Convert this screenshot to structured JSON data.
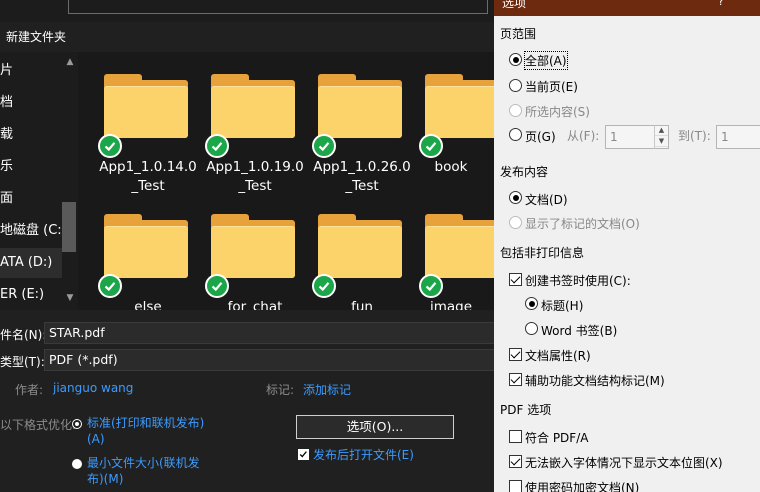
{
  "save_dialog": {
    "toolbar": {
      "new_folder": "新建文件夹"
    },
    "nav_items": [
      {
        "label": "片",
        "selected": false
      },
      {
        "label": "档",
        "selected": false
      },
      {
        "label": "载",
        "selected": false
      },
      {
        "label": "乐",
        "selected": false
      },
      {
        "label": "面",
        "selected": false
      },
      {
        "label": "地磁盘 (C:)",
        "selected": false
      },
      {
        "label": "ATA (D:)",
        "selected": true
      },
      {
        "label": "ER (E:)",
        "selected": false
      }
    ],
    "nav_scroll": {
      "up": "▲",
      "down": "▼"
    },
    "files": [
      {
        "line1": "App1_1.0.14.0",
        "line2": "_Test"
      },
      {
        "line1": "App1_1.0.19.0",
        "line2": "_Test"
      },
      {
        "line1": "App1_1.0.26.0",
        "line2": "_Test"
      },
      {
        "line1": "book",
        "line2": ""
      },
      {
        "line1": "else",
        "line2": ""
      },
      {
        "line1": "for_chat",
        "line2": ""
      },
      {
        "line1": "fun",
        "line2": ""
      },
      {
        "line1": "image",
        "line2": ""
      }
    ],
    "filename_label": "件名(N):",
    "filename_value": "STAR.pdf",
    "filetype_label": "类型(T):",
    "filetype_value": "PDF (*.pdf)",
    "author_label": "作者:",
    "author_value": "jianguo wang",
    "tags_label": "标记:",
    "tags_value": "添加标记",
    "optimize_label": "以下格式优化:",
    "opt_standard_line1": "标准(打印和联机发布)",
    "opt_standard_line2": "(A)",
    "opt_min_line1": "最小文件大小(联机发",
    "opt_min_line2": "布)(M)",
    "options_button": "选项(O)...",
    "open_after_publish": "发布后打开文件(E)"
  },
  "options_panel": {
    "title": "选项",
    "help": "?",
    "page_range": {
      "heading": "页范围",
      "all": "全部(A)",
      "current": "当前页(E)",
      "selection": "所选内容(S)",
      "pages": "页(G)",
      "from_label": "从(F):",
      "from_value": "1",
      "to_label": "到(T):",
      "to_value": "1"
    },
    "publish": {
      "heading": "发布内容",
      "document": "文档(D)",
      "markup": "显示了标记的文档(O)"
    },
    "nonprint": {
      "heading": "包括非打印信息",
      "bookmarks": "创建书签时使用(C):",
      "headings": "标题(H)",
      "word_bookmarks": "Word 书签(B)",
      "props": "文档属性(R)",
      "tags": "辅助功能文档结构标记(M)"
    },
    "pdf_options": {
      "heading": "PDF 选项",
      "pdfa": "符合 PDF/A",
      "bitmap": "无法嵌入字体情况下显示文本位图(X)",
      "encrypt": "使用密码加密文档(N)"
    }
  }
}
